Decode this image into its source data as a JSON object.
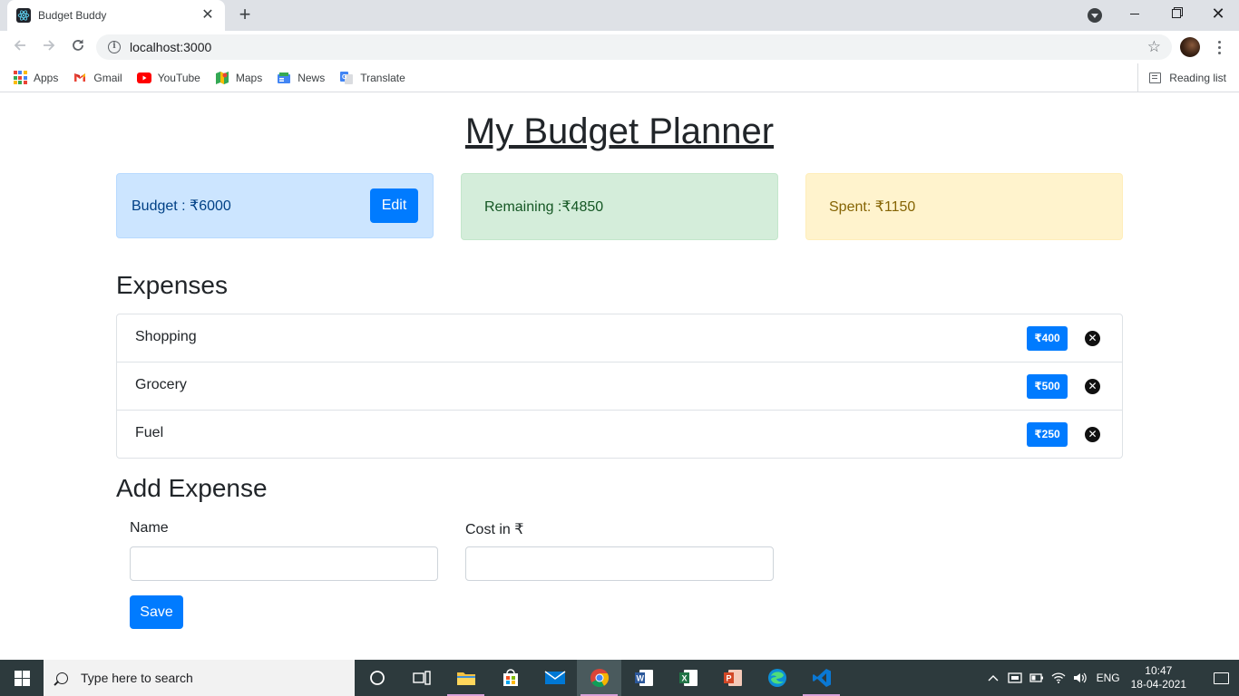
{
  "browser": {
    "tab_title": "Budget Buddy",
    "tab_close": "✕",
    "new_tab": "+",
    "url": "localhost:3000",
    "bookmarks": [
      {
        "label": "Apps",
        "icon": "apps-grid-icon"
      },
      {
        "label": "Gmail",
        "icon": "gmail-icon"
      },
      {
        "label": "YouTube",
        "icon": "youtube-icon"
      },
      {
        "label": "Maps",
        "icon": "maps-icon"
      },
      {
        "label": "News",
        "icon": "news-icon"
      },
      {
        "label": "Translate",
        "icon": "translate-icon"
      }
    ],
    "reading_list": "Reading list"
  },
  "page": {
    "title": "My Budget Planner",
    "budget": {
      "text": "Budget : ₹6000",
      "edit_label": "Edit"
    },
    "remaining": {
      "text": "Remaining :₹4850"
    },
    "spent": {
      "text": "Spent: ₹1150"
    },
    "expenses_heading": "Expenses",
    "expenses": [
      {
        "name": "Shopping",
        "cost": "₹400"
      },
      {
        "name": "Grocery",
        "cost": "₹500"
      },
      {
        "name": "Fuel",
        "cost": "₹250"
      }
    ],
    "add_heading": "Add Expense",
    "form": {
      "name_label": "Name",
      "name_value": "",
      "cost_label": "Cost in ₹",
      "cost_value": "",
      "save_label": "Save"
    }
  },
  "taskbar": {
    "search_placeholder": "Type here to search",
    "lang": "ENG",
    "time": "10:47",
    "date": "18-04-2021"
  },
  "colors": {
    "primary": "#007bff",
    "budget_bg": "#cce5ff",
    "remaining_bg": "#d4edda",
    "spent_bg": "#fff3cd"
  }
}
